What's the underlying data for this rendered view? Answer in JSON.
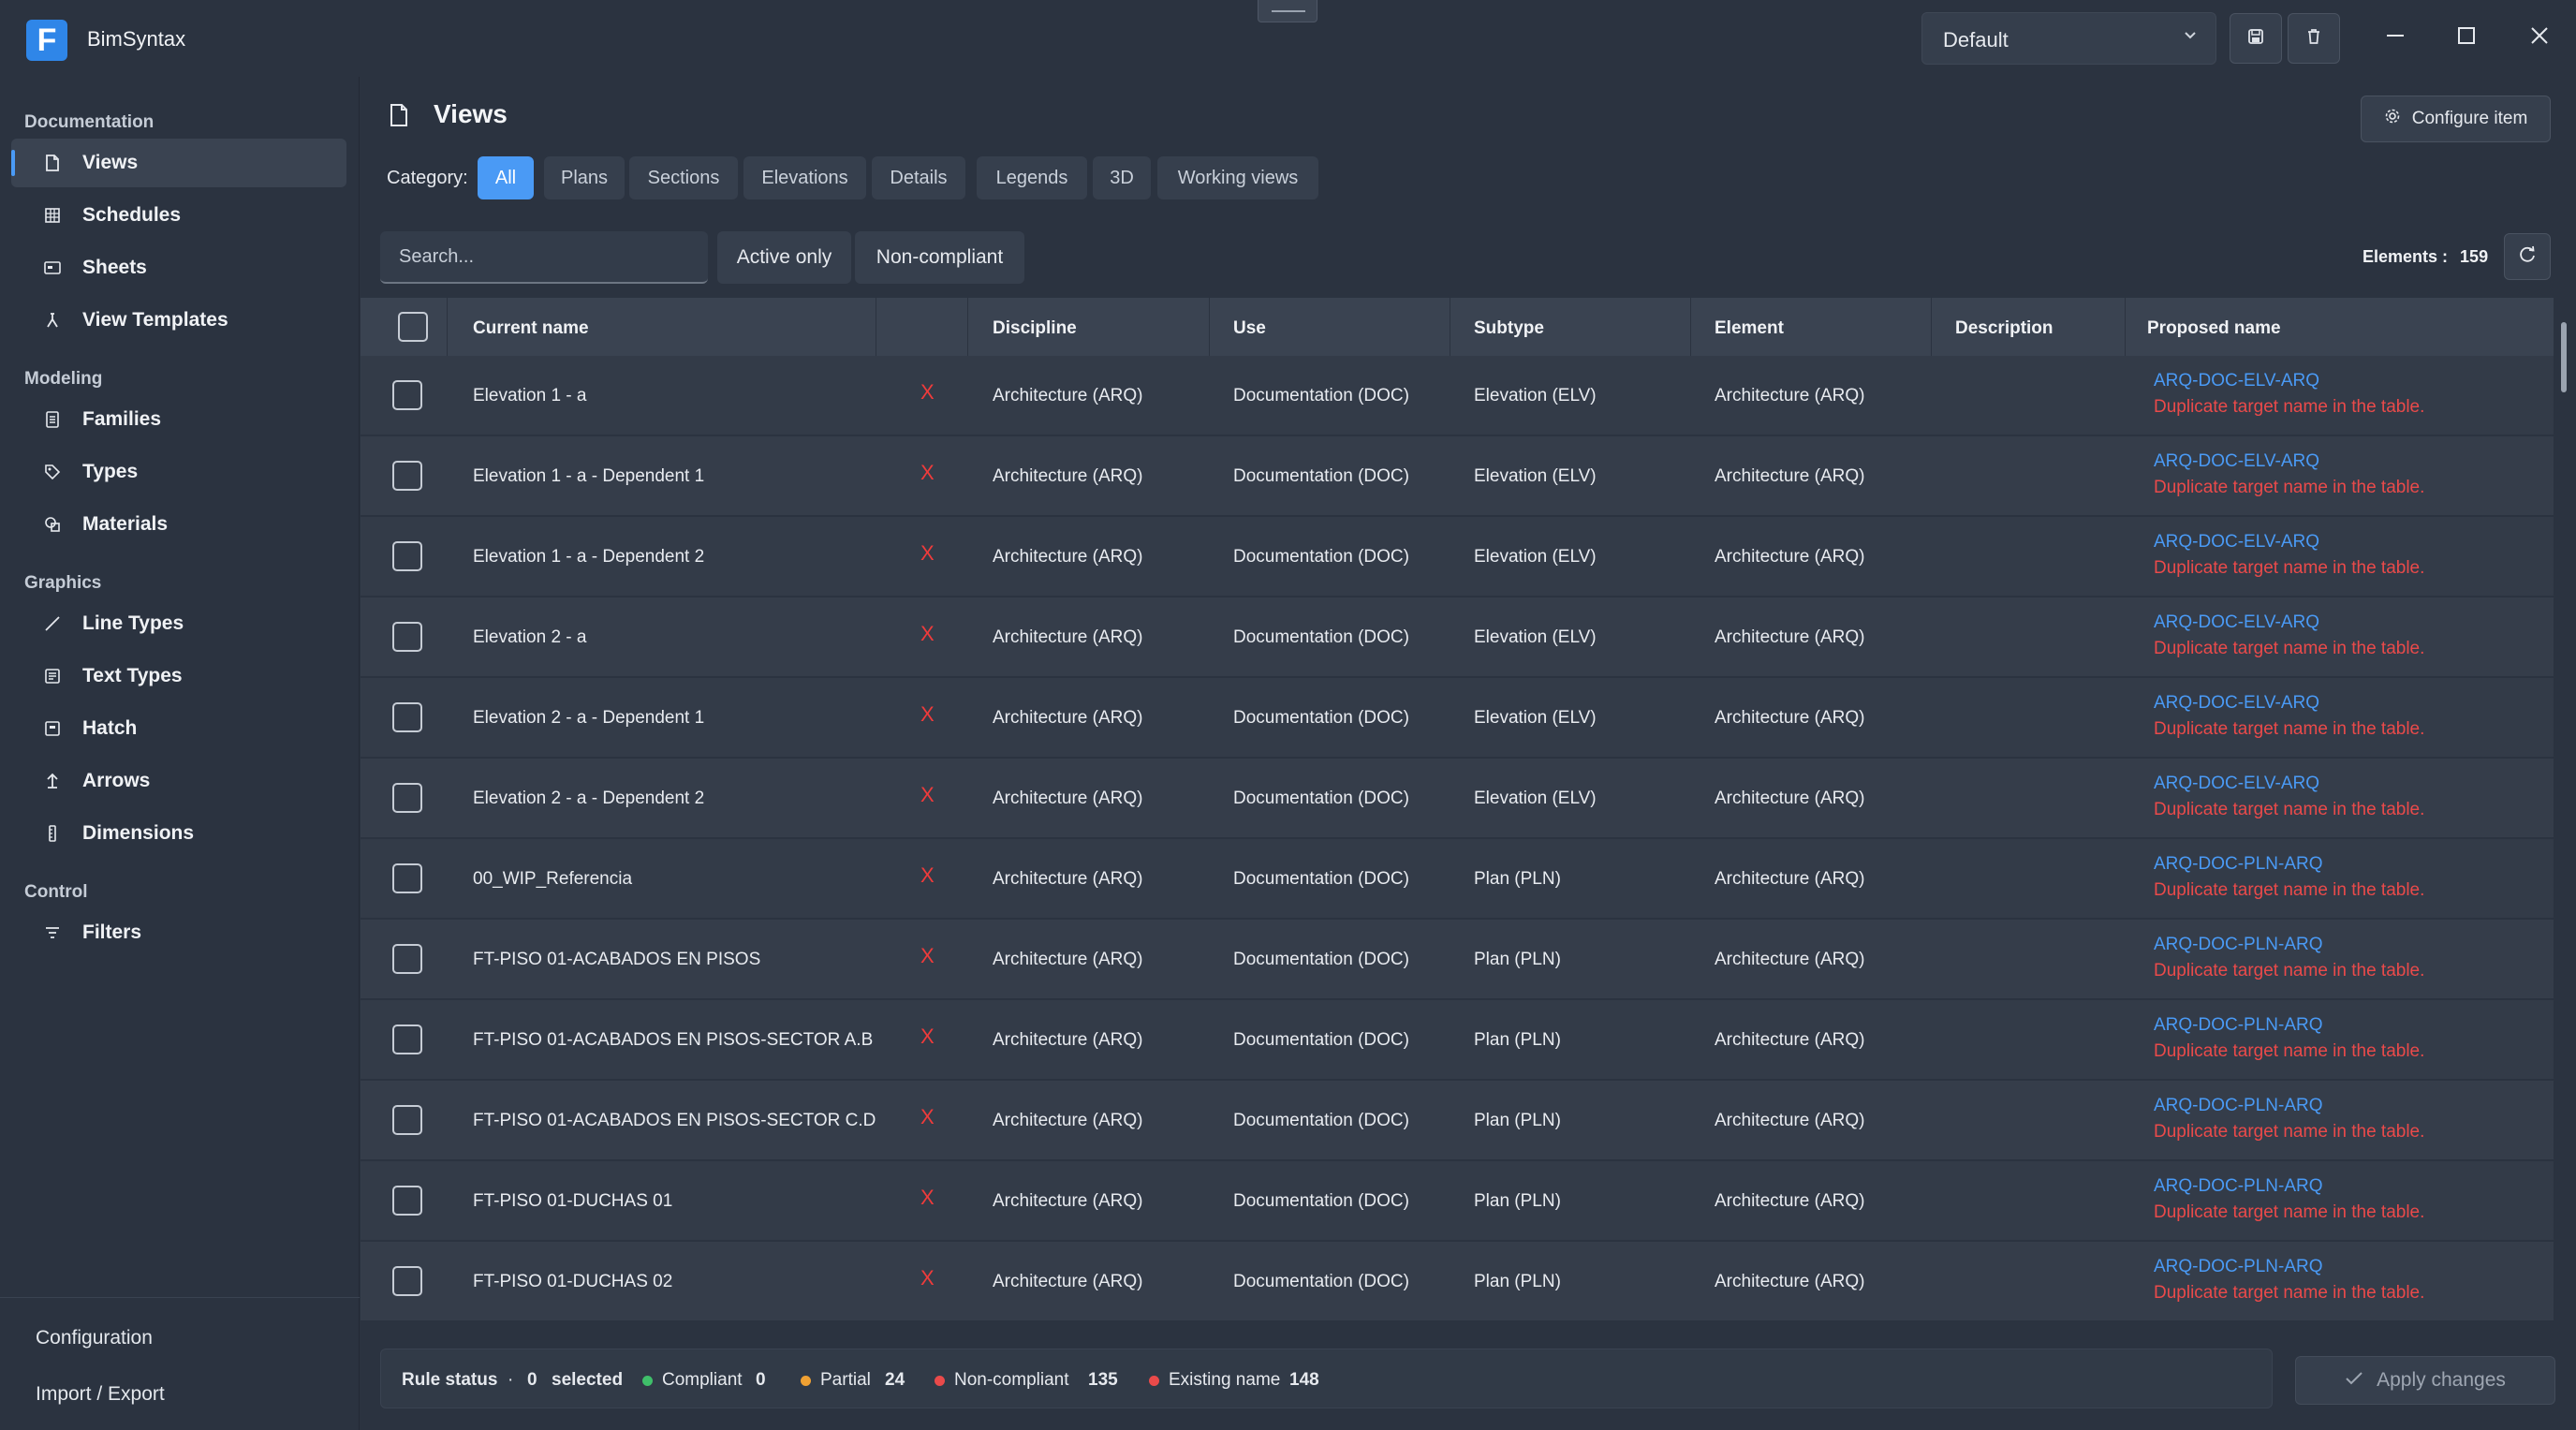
{
  "app": {
    "title": "BimSyntax",
    "logo_letter": "F",
    "accent": "#2f86e8"
  },
  "profile": {
    "value": "Default"
  },
  "sidebar": {
    "groups": [
      {
        "label": "Documentation",
        "items": [
          "Views",
          "Schedules",
          "Sheets",
          "View Templates"
        ]
      },
      {
        "label": "Modeling",
        "items": [
          "Families",
          "Types",
          "Materials"
        ]
      },
      {
        "label": "Graphics",
        "items": [
          "Line Types",
          "Text Types",
          "Hatch",
          "Arrows",
          "Dimensions"
        ]
      },
      {
        "label": "Control",
        "items": [
          "Filters"
        ]
      }
    ],
    "footer": [
      "Configuration",
      "Import / Export"
    ]
  },
  "page": {
    "title": "Views",
    "configure_label": "Configure item",
    "category_label": "Category:",
    "categories": [
      "All",
      "Plans",
      "Sections",
      "Elevations",
      "Details",
      "Legends",
      "3D",
      "Working views"
    ],
    "active_category": "All",
    "search_placeholder": "Search...",
    "filters": [
      "Active only",
      "Non-compliant"
    ],
    "elements_label": "Elements :",
    "elements_count": "159"
  },
  "table": {
    "columns": [
      "Current name",
      "Discipline",
      "Use",
      "Subtype",
      "Element",
      "Description",
      "Proposed name"
    ],
    "rows": [
      {
        "name": "Elevation 1 - a",
        "status": "X",
        "discipline": "Architecture (ARQ)",
        "use": "Documentation (DOC)",
        "subtype": "Elevation (ELV)",
        "element": "Architecture (ARQ)",
        "description": "",
        "proposed": "ARQ-DOC-ELV-ARQ",
        "error": "Duplicate target name in the table."
      },
      {
        "name": "Elevation 1 - a - Dependent 1",
        "status": "X",
        "discipline": "Architecture (ARQ)",
        "use": "Documentation (DOC)",
        "subtype": "Elevation (ELV)",
        "element": "Architecture (ARQ)",
        "description": "",
        "proposed": "ARQ-DOC-ELV-ARQ",
        "error": "Duplicate target name in the table."
      },
      {
        "name": "Elevation 1 - a - Dependent 2",
        "status": "X",
        "discipline": "Architecture (ARQ)",
        "use": "Documentation (DOC)",
        "subtype": "Elevation (ELV)",
        "element": "Architecture (ARQ)",
        "description": "",
        "proposed": "ARQ-DOC-ELV-ARQ",
        "error": "Duplicate target name in the table."
      },
      {
        "name": "Elevation 2 - a",
        "status": "X",
        "discipline": "Architecture (ARQ)",
        "use": "Documentation (DOC)",
        "subtype": "Elevation (ELV)",
        "element": "Architecture (ARQ)",
        "description": "",
        "proposed": "ARQ-DOC-ELV-ARQ",
        "error": "Duplicate target name in the table."
      },
      {
        "name": "Elevation 2 - a - Dependent 1",
        "status": "X",
        "discipline": "Architecture (ARQ)",
        "use": "Documentation (DOC)",
        "subtype": "Elevation (ELV)",
        "element": "Architecture (ARQ)",
        "description": "",
        "proposed": "ARQ-DOC-ELV-ARQ",
        "error": "Duplicate target name in the table."
      },
      {
        "name": "Elevation 2 - a - Dependent 2",
        "status": "X",
        "discipline": "Architecture (ARQ)",
        "use": "Documentation (DOC)",
        "subtype": "Elevation (ELV)",
        "element": "Architecture (ARQ)",
        "description": "",
        "proposed": "ARQ-DOC-ELV-ARQ",
        "error": "Duplicate target name in the table."
      },
      {
        "name": "00_WIP_Referencia",
        "status": "X",
        "discipline": "Architecture (ARQ)",
        "use": "Documentation (DOC)",
        "subtype": "Plan (PLN)",
        "element": "Architecture (ARQ)",
        "description": "",
        "proposed": "ARQ-DOC-PLN-ARQ",
        "error": "Duplicate target name in the table."
      },
      {
        "name": "FT-PISO 01-ACABADOS EN PISOS",
        "status": "X",
        "discipline": "Architecture (ARQ)",
        "use": "Documentation (DOC)",
        "subtype": "Plan (PLN)",
        "element": "Architecture (ARQ)",
        "description": "",
        "proposed": "ARQ-DOC-PLN-ARQ",
        "error": "Duplicate target name in the table."
      },
      {
        "name": "FT-PISO 01-ACABADOS EN PISOS-SECTOR A.B",
        "status": "X",
        "discipline": "Architecture (ARQ)",
        "use": "Documentation (DOC)",
        "subtype": "Plan (PLN)",
        "element": "Architecture (ARQ)",
        "description": "",
        "proposed": "ARQ-DOC-PLN-ARQ",
        "error": "Duplicate target name in the table."
      },
      {
        "name": "FT-PISO 01-ACABADOS EN PISOS-SECTOR C.D",
        "status": "X",
        "discipline": "Architecture (ARQ)",
        "use": "Documentation (DOC)",
        "subtype": "Plan (PLN)",
        "element": "Architecture (ARQ)",
        "description": "",
        "proposed": "ARQ-DOC-PLN-ARQ",
        "error": "Duplicate target name in the table."
      },
      {
        "name": "FT-PISO 01-DUCHAS 01",
        "status": "X",
        "discipline": "Architecture (ARQ)",
        "use": "Documentation (DOC)",
        "subtype": "Plan (PLN)",
        "element": "Architecture (ARQ)",
        "description": "",
        "proposed": "ARQ-DOC-PLN-ARQ",
        "error": "Duplicate target name in the table."
      },
      {
        "name": "FT-PISO 01-DUCHAS 02",
        "status": "X",
        "discipline": "Architecture (ARQ)",
        "use": "Documentation (DOC)",
        "subtype": "Plan (PLN)",
        "element": "Architecture (ARQ)",
        "description": "",
        "proposed": "ARQ-DOC-PLN-ARQ",
        "error": "Duplicate target name in the table."
      }
    ]
  },
  "status": {
    "rule_label": "Rule status",
    "separator": "·",
    "selected_count": "0",
    "selected_label": "selected",
    "compliant_label": "Compliant",
    "compliant_count": "0",
    "compliant_color": "#3fbf6a",
    "partial_label": "Partial",
    "partial_count": "24",
    "partial_color": "#f0a133",
    "noncompliant_label": "Non-compliant",
    "noncompliant_count": "135",
    "noncompliant_color": "#ea4a4a",
    "existing_label": "Existing name",
    "existing_count": "148",
    "existing_color": "#ea4a4a"
  },
  "apply_label": "Apply changes"
}
